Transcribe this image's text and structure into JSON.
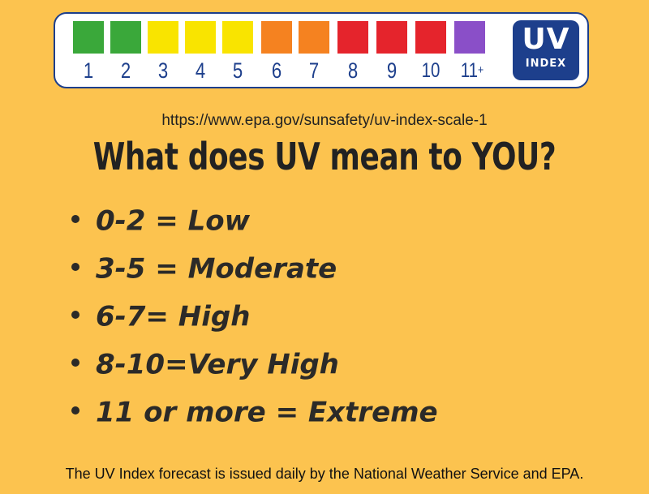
{
  "uv_scale": {
    "levels": [
      {
        "label": "1",
        "color": "#3AA83A"
      },
      {
        "label": "2",
        "color": "#3AA83A"
      },
      {
        "label": "3",
        "color": "#F9E400"
      },
      {
        "label": "4",
        "color": "#F9E400"
      },
      {
        "label": "5",
        "color": "#F9E400"
      },
      {
        "label": "6",
        "color": "#F58220"
      },
      {
        "label": "7",
        "color": "#F58220"
      },
      {
        "label": "8",
        "color": "#E5242C"
      },
      {
        "label": "9",
        "color": "#E5242C"
      },
      {
        "label": "10",
        "color": "#E5242C"
      },
      {
        "label": "11",
        "suffix": "+",
        "color": "#8A4FC8"
      }
    ],
    "logo_big": "UV",
    "logo_small": "INDEX"
  },
  "url": "https://www.epa.gov/sunsafety/uv-index-scale-1",
  "headline": "What does UV mean to YOU?",
  "categories": [
    {
      "text": "0-2 = Low"
    },
    {
      "text": "3-5 = Moderate"
    },
    {
      "text": "6-7= High"
    },
    {
      "text": "8-10=Very High"
    },
    {
      "text": "11 or more = Extreme"
    }
  ],
  "footer": "The UV Index forecast is issued daily by the National Weather Service and EPA.",
  "colors": {
    "background": "#FCC34F",
    "brand_blue": "#1d3f8c"
  }
}
